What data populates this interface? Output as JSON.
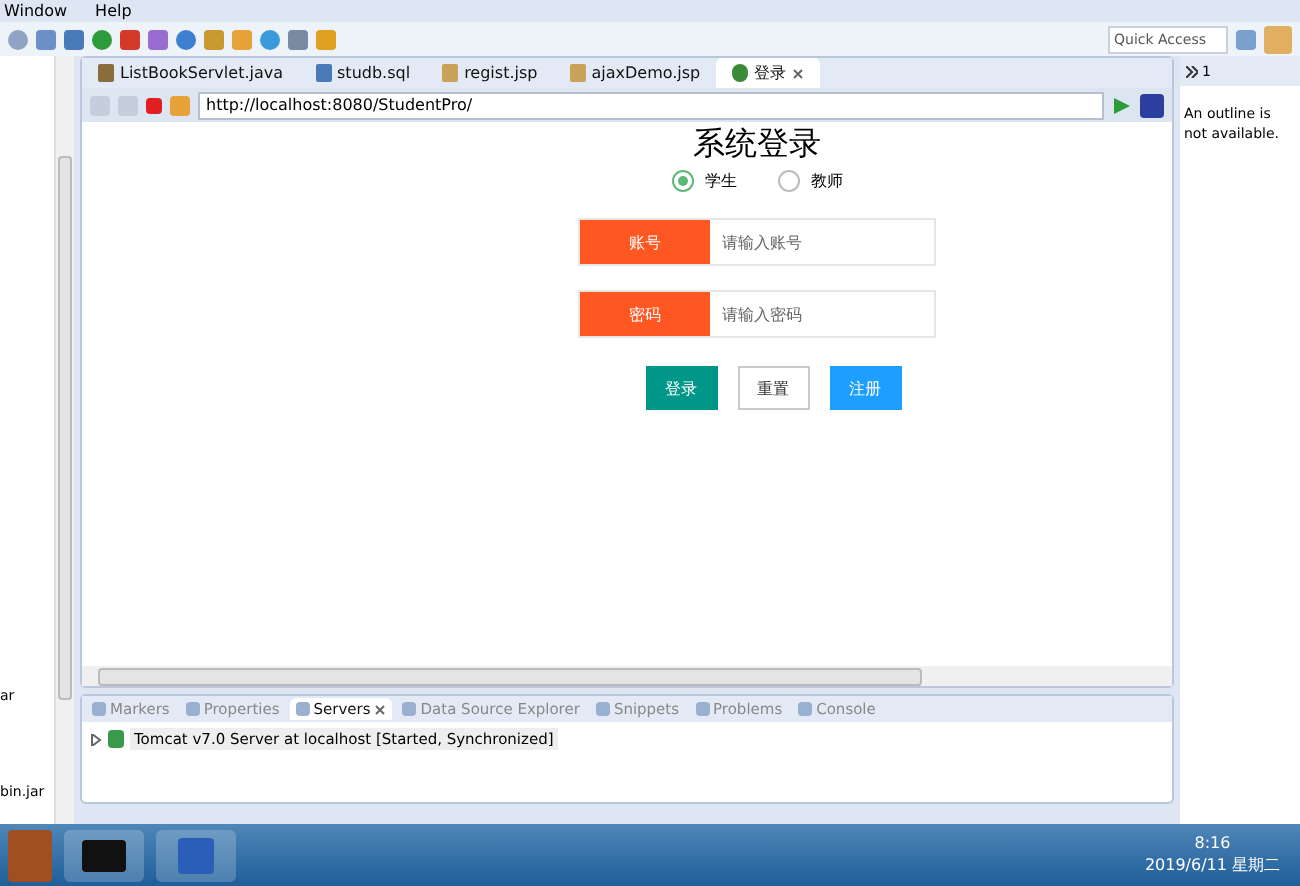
{
  "menu": [
    "Window",
    "Help"
  ],
  "toolbar": {
    "quick_access": {
      "placeholder": "Quick Access"
    }
  },
  "left_panel": {
    "items": [
      "ar",
      "bin.jar"
    ]
  },
  "editor_tabs": [
    {
      "label": "ListBookServlet.java",
      "selected": false,
      "kind": "java"
    },
    {
      "label": "studb.sql",
      "selected": false,
      "kind": "sql"
    },
    {
      "label": "regist.jsp",
      "selected": false,
      "kind": "jsp"
    },
    {
      "label": "ajaxDemo.jsp",
      "selected": false,
      "kind": "jsp"
    },
    {
      "label": "登录",
      "selected": true,
      "kind": "web"
    }
  ],
  "browser": {
    "url": "http://localhost:8080/StudentPro/"
  },
  "login": {
    "title": "系统登录",
    "roles": [
      {
        "label": "学生",
        "selected": true
      },
      {
        "label": "教师",
        "selected": false
      }
    ],
    "fields": [
      {
        "label": "账号",
        "placeholder": "请输入账号"
      },
      {
        "label": "密码",
        "placeholder": "请输入密码"
      }
    ],
    "buttons": [
      {
        "label": "登录",
        "kind": "primary"
      },
      {
        "label": "重置",
        "kind": "plain"
      },
      {
        "label": "注册",
        "kind": "info"
      }
    ]
  },
  "outline": {
    "tab": "1",
    "message": "An outline is not available."
  },
  "bottom_tabs": [
    {
      "label": "Markers",
      "selected": false
    },
    {
      "label": "Properties",
      "selected": false
    },
    {
      "label": "Servers",
      "selected": true
    },
    {
      "label": "Data Source Explorer",
      "selected": false
    },
    {
      "label": "Snippets",
      "selected": false
    },
    {
      "label": "Problems",
      "selected": false
    },
    {
      "label": "Console",
      "selected": false
    }
  ],
  "servers": [
    {
      "name": "Tomcat v7.0 Server at localhost",
      "status": "[Started, Synchronized]",
      "expanded": false
    }
  ],
  "taskbar": {
    "time": "8:16",
    "date": "2019/6/11 星期二"
  }
}
